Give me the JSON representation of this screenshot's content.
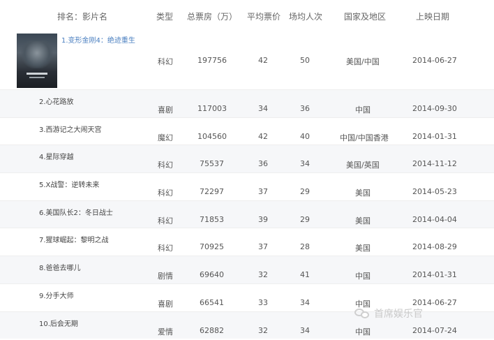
{
  "header": {
    "rank_name": "排名：影片名",
    "genre": "类型",
    "box_office": "总票房（万）",
    "avg_price": "平均票价",
    "avg_audience": "场均人次",
    "country": "国家及地区",
    "release_date": "上映日期"
  },
  "rows": [
    {
      "name": "1.变形金刚4：绝迹重生",
      "genre": "科幻",
      "box_office": "197756",
      "avg_price": "42",
      "avg_audience": "50",
      "country": "美国/中国",
      "release_date": "2014-06-27"
    },
    {
      "name": "2.心花路放",
      "genre": "喜剧",
      "box_office": "117003",
      "avg_price": "34",
      "avg_audience": "36",
      "country": "中国",
      "release_date": "2014-09-30"
    },
    {
      "name": "3.西游记之大闹天宫",
      "genre": "魔幻",
      "box_office": "104560",
      "avg_price": "42",
      "avg_audience": "40",
      "country": "中国/中国香港",
      "release_date": "2014-01-31"
    },
    {
      "name": "4.星际穿越",
      "genre": "科幻",
      "box_office": "75537",
      "avg_price": "36",
      "avg_audience": "34",
      "country": "美国/英国",
      "release_date": "2014-11-12"
    },
    {
      "name": "5.X战警：逆转未来",
      "genre": "科幻",
      "box_office": "72297",
      "avg_price": "37",
      "avg_audience": "29",
      "country": "美国",
      "release_date": "2014-05-23"
    },
    {
      "name": "6.美国队长2：冬日战士",
      "genre": "科幻",
      "box_office": "71853",
      "avg_price": "39",
      "avg_audience": "29",
      "country": "美国",
      "release_date": "2014-04-04"
    },
    {
      "name": "7.猩球崛起：黎明之战",
      "genre": "科幻",
      "box_office": "70925",
      "avg_price": "37",
      "avg_audience": "28",
      "country": "美国",
      "release_date": "2014-08-29"
    },
    {
      "name": "8.爸爸去哪儿",
      "genre": "剧情",
      "box_office": "69640",
      "avg_price": "32",
      "avg_audience": "41",
      "country": "中国",
      "release_date": "2014-01-31"
    },
    {
      "name": "9.分手大师",
      "genre": "喜剧",
      "box_office": "66541",
      "avg_price": "33",
      "avg_audience": "34",
      "country": "中国",
      "release_date": "2014-06-27"
    },
    {
      "name": "10.后会无期",
      "genre": "爱情",
      "box_office": "62882",
      "avg_price": "32",
      "avg_audience": "34",
      "country": "中国",
      "release_date": "2014-07-24"
    }
  ],
  "watermark": {
    "icon": "wechat-icon",
    "text": "首席娱乐官"
  }
}
